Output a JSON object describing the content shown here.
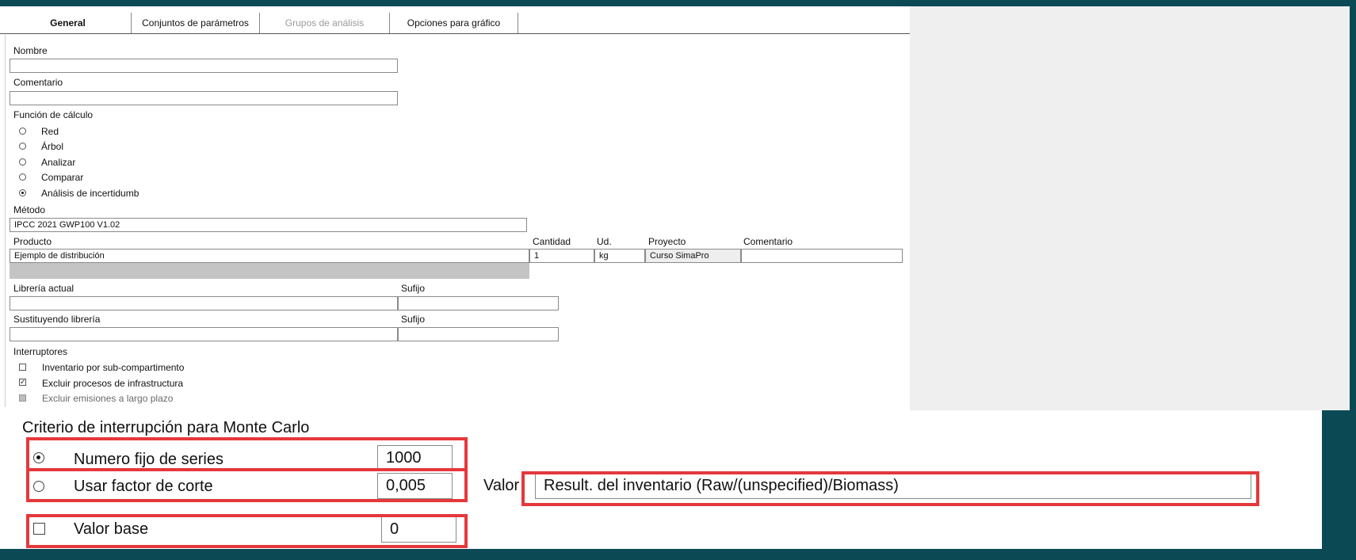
{
  "tabs": [
    {
      "label": "General",
      "active": true
    },
    {
      "label": "Conjuntos de parámetros"
    },
    {
      "label": "Grupos de análisis",
      "disabled": true
    },
    {
      "label": "Opciones para gráfico"
    }
  ],
  "form": {
    "name_label": "Nombre",
    "name_value": "",
    "comment_label": "Comentario",
    "comment_value": "",
    "calc_label": "Función de cálculo",
    "calc_options": [
      {
        "label": "Red",
        "selected": false
      },
      {
        "label": "Árbol",
        "selected": false
      },
      {
        "label": "Analizar",
        "selected": false
      },
      {
        "label": "Comparar",
        "selected": false
      },
      {
        "label": "Análisis de incertidumb",
        "selected": true
      }
    ],
    "method_label": "Método",
    "method_value": "IPCC 2021 GWP100 V1.02",
    "product_table": {
      "headers": [
        "Producto",
        "Cantidad",
        "Ud.",
        "Proyecto",
        "Comentario"
      ],
      "row": [
        "Ejemplo de distribución",
        "1",
        "kg",
        "Curso SimaPro",
        ""
      ]
    },
    "library_label": "Librería actual",
    "library_value": "",
    "suffix_label": "Sufijo",
    "suffix_value": "",
    "replace_label": "Sustituyendo librería",
    "replace_value": "",
    "suffix2_label": "Sufijo",
    "suffix2_value": "",
    "switches_label": "Interruptores",
    "switches": [
      {
        "label": "Inventario por sub-compartimento",
        "checked": false,
        "disabled": false
      },
      {
        "label": "Excluir procesos de infrastructura",
        "checked": true,
        "disabled": false
      },
      {
        "label": "Excluir emisiones a largo plazo",
        "checked": false,
        "disabled": true
      }
    ]
  },
  "montecarlo": {
    "title": "Criterio de interrupción para Monte Carlo",
    "fixed_label": "Numero fijo de series",
    "fixed_value": "1000",
    "fixed_selected": true,
    "cutoff_label": "Usar factor de corte",
    "cutoff_value": "0,005",
    "cutoff_selected": false,
    "valor_label": "Valor",
    "valor_value": "Result. del inventario (Raw/(unspecified)/Biomass)",
    "base_label": "Valor base",
    "base_value": "0",
    "base_checked": false
  },
  "colors": {
    "highlight": "#e5383b",
    "frame": "#0b4a55"
  }
}
